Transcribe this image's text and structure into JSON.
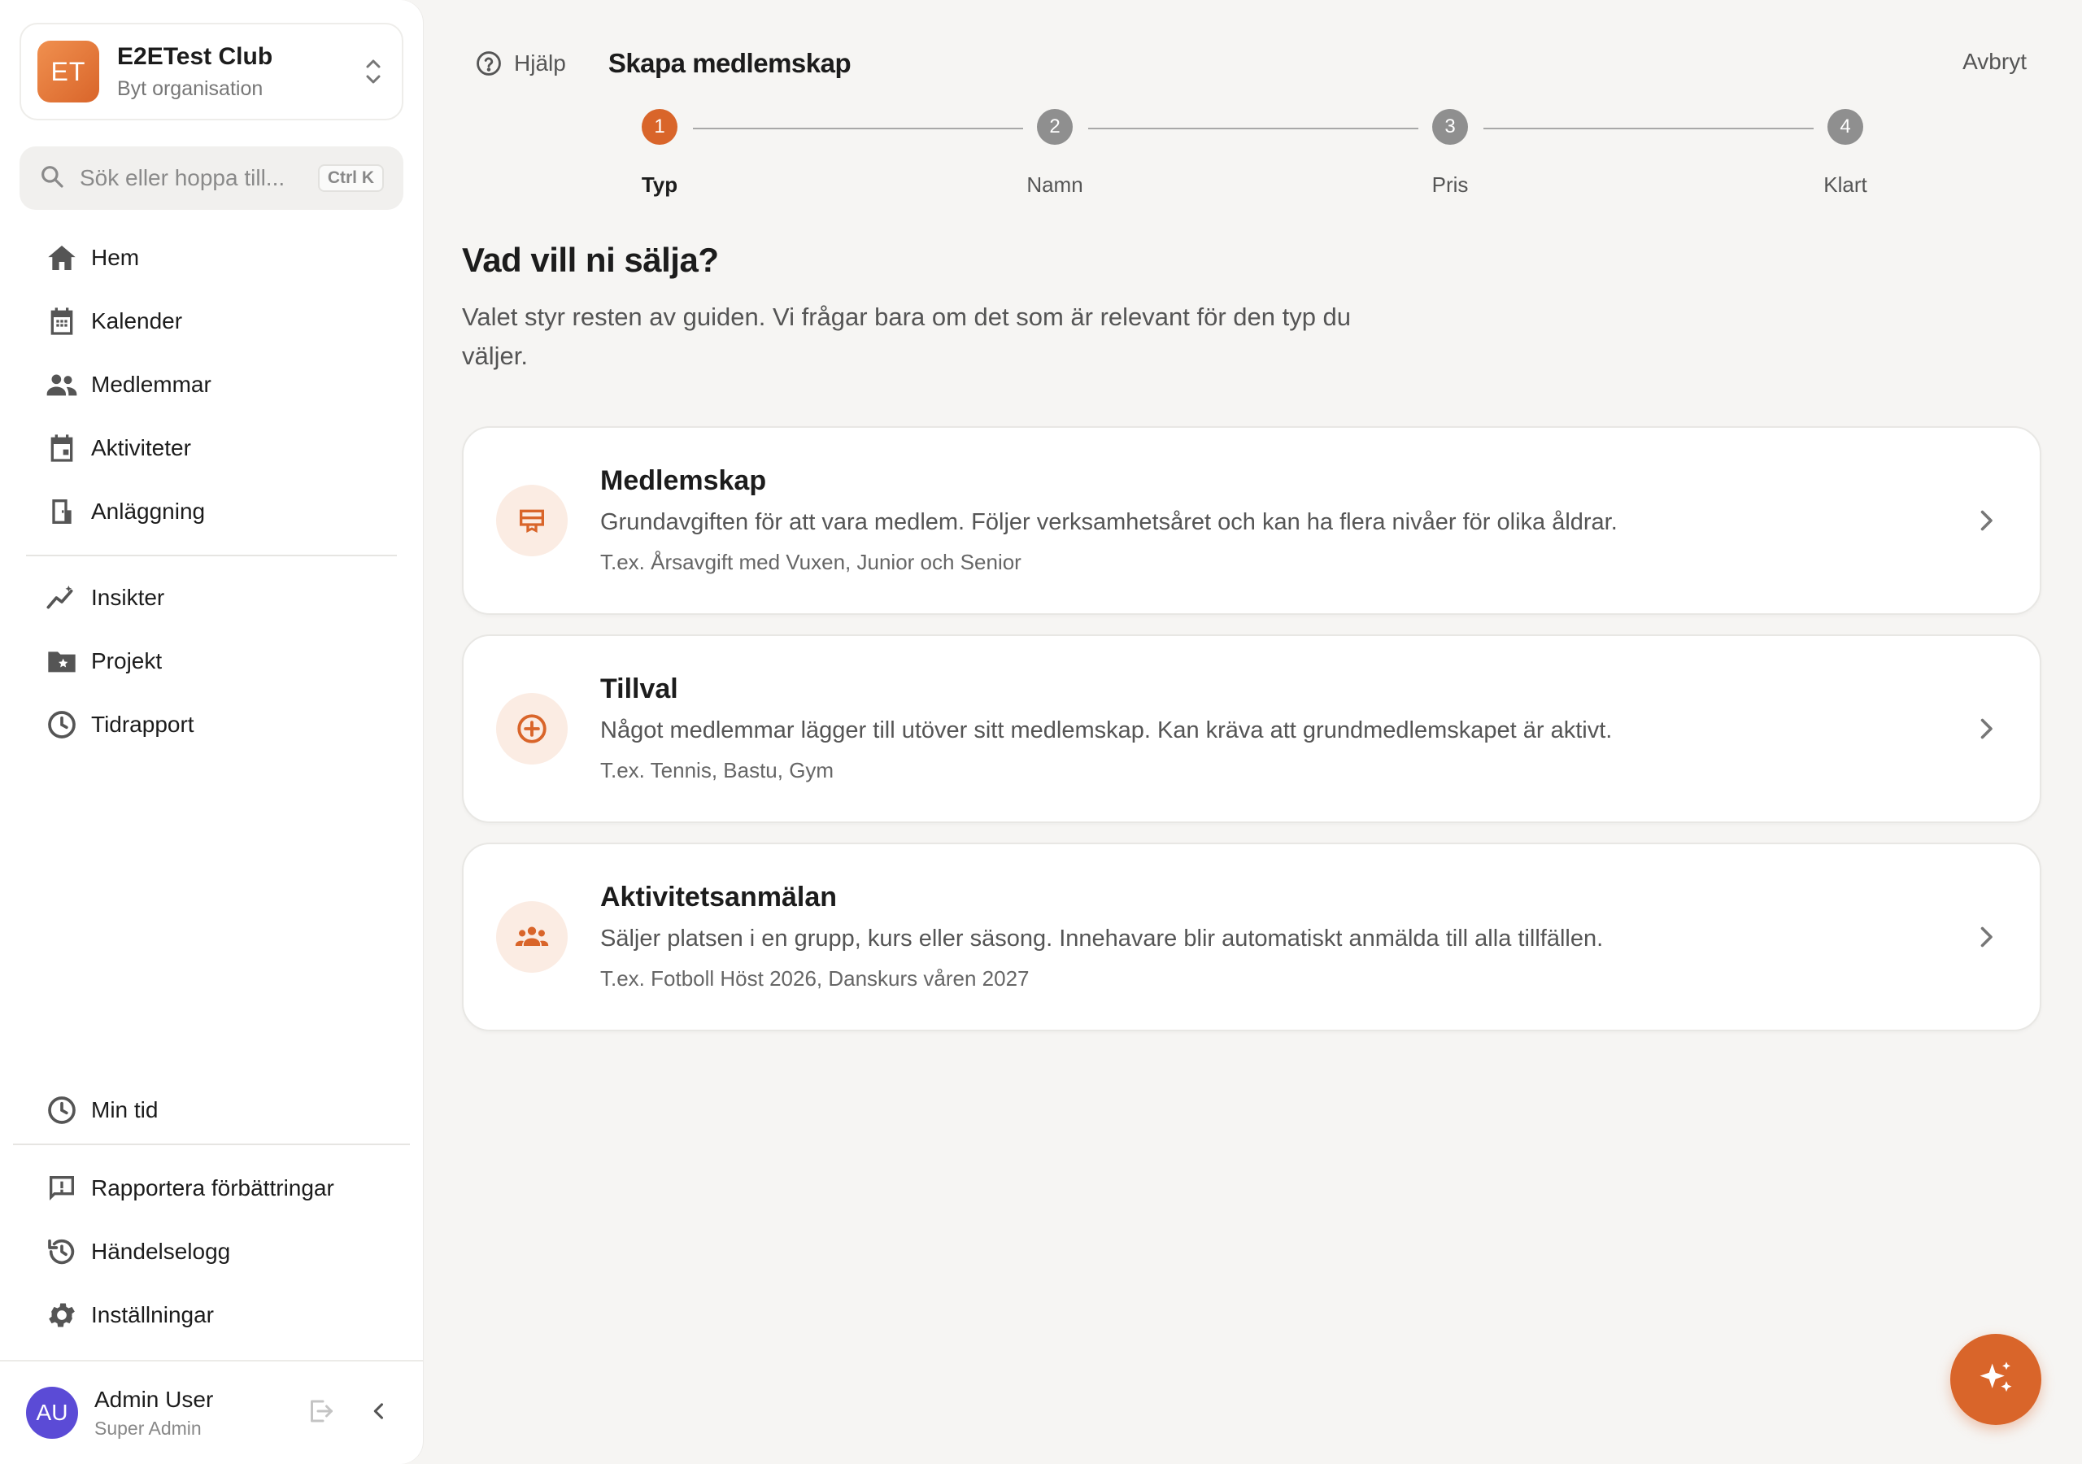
{
  "org": {
    "initials": "ET",
    "name": "E2ETest Club",
    "subtitle": "Byt organisation"
  },
  "search": {
    "placeholder": "Sök eller hoppa till...",
    "shortcut": "Ctrl K"
  },
  "nav_primary": [
    {
      "label": "Hem",
      "icon": "home-icon"
    },
    {
      "label": "Kalender",
      "icon": "calendar-icon"
    },
    {
      "label": "Medlemmar",
      "icon": "people-icon"
    },
    {
      "label": "Aktiviteter",
      "icon": "event-icon"
    },
    {
      "label": "Anläggning",
      "icon": "facility-icon"
    }
  ],
  "nav_secondary": [
    {
      "label": "Insikter",
      "icon": "insights-icon"
    },
    {
      "label": "Projekt",
      "icon": "project-folder-icon"
    },
    {
      "label": "Tidrapport",
      "icon": "clock-icon"
    }
  ],
  "nav_bottom": [
    {
      "label": "Min tid",
      "icon": "clock-icon"
    },
    {
      "label": "Rapportera förbättringar",
      "icon": "feedback-icon"
    },
    {
      "label": "Händelselogg",
      "icon": "history-icon"
    },
    {
      "label": "Inställningar",
      "icon": "gear-icon"
    }
  ],
  "user": {
    "initials": "AU",
    "name": "Admin User",
    "role": "Super Admin"
  },
  "topbar": {
    "help": "Hjälp",
    "title": "Skapa medlemskap",
    "cancel": "Avbryt"
  },
  "stepper": {
    "current": 1,
    "steps": [
      {
        "number": "1",
        "label": "Typ"
      },
      {
        "number": "2",
        "label": "Namn"
      },
      {
        "number": "3",
        "label": "Pris"
      },
      {
        "number": "4",
        "label": "Klart"
      }
    ]
  },
  "main": {
    "heading": "Vad vill ni sälja?",
    "intro": "Valet styr resten av guiden. Vi frågar bara om det som är relevant för den typ du väljer."
  },
  "options": [
    {
      "title": "Medlemskap",
      "description": "Grundavgiften för att vara medlem. Följer verksamhetsåret och kan ha flera nivåer för olika åldrar.",
      "example": "T.ex. Årsavgift med Vuxen, Junior och Senior",
      "icon": "membership-card-icon"
    },
    {
      "title": "Tillval",
      "description": "Något medlemmar lägger till utöver sitt medlemskap. Kan kräva att grundmedlemskapet är aktivt.",
      "example": "T.ex. Tennis, Bastu, Gym",
      "icon": "add-circle-icon"
    },
    {
      "title": "Aktivitetsanmälan",
      "description": "Säljer platsen i en grupp, kurs eller säsong. Innehavare blir automatiskt anmälda till alla tillfällen.",
      "example": "T.ex. Fotboll Höst 2026, Danskurs våren 2027",
      "icon": "group-icon"
    }
  ],
  "colors": {
    "accent": "#d9652a",
    "accent_soft": "#fbece3",
    "user_avatar": "#5b4bd6",
    "background": "#f6f5f3"
  },
  "fab": {
    "icon": "sparkle-icon"
  }
}
